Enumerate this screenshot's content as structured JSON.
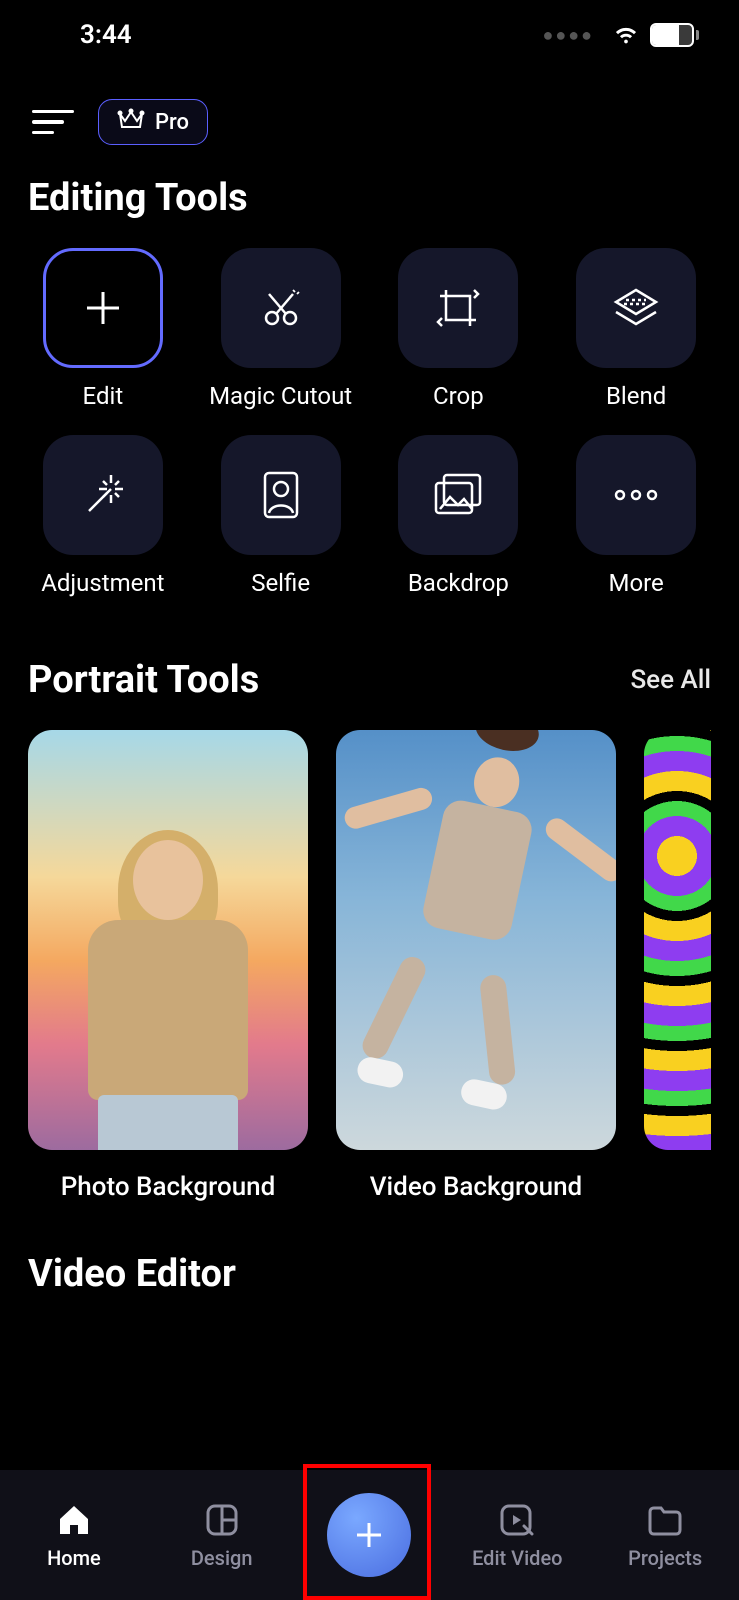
{
  "status": {
    "time": "3:44",
    "battery": "68"
  },
  "topbar": {
    "pro_label": "Pro"
  },
  "sections": {
    "editing_title": "Editing Tools",
    "portrait_title": "Portrait Tools",
    "portrait_see_all": "See All",
    "video_title": "Video Editor"
  },
  "tools": [
    {
      "label": "Edit"
    },
    {
      "label": "Magic Cutout"
    },
    {
      "label": "Crop"
    },
    {
      "label": "Blend"
    },
    {
      "label": "Adjustment"
    },
    {
      "label": "Selfie"
    },
    {
      "label": "Backdrop"
    },
    {
      "label": "More"
    }
  ],
  "portrait_cards": [
    {
      "label": "Photo Background"
    },
    {
      "label": "Video Background"
    }
  ],
  "nav": {
    "home": "Home",
    "design": "Design",
    "edit_video": "Edit Video",
    "projects": "Projects"
  }
}
